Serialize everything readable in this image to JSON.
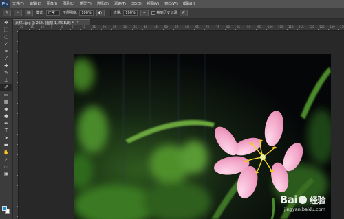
{
  "app": {
    "logo": "Ps"
  },
  "menu": [
    "文件(F)",
    "编辑(E)",
    "图像(I)",
    "图层(L)",
    "类型(Y)",
    "选择(S)",
    "滤镜(T)",
    "3D(D)",
    "视图(V)",
    "窗口(W)",
    "帮助(H)"
  ],
  "options": {
    "mode_label": "模式:",
    "mode_value": "正常",
    "opacity_label": "不透明度:",
    "opacity_value": "100%",
    "flow_label": "流量:",
    "flow_value": "100%",
    "history_label": "抹到历史记录"
  },
  "document": {
    "tab_title": "素材1.jpg @ 25% (图层 1, RGB/8) *",
    "close": "×"
  },
  "ruler_top": [
    "20",
    "15",
    "10",
    "5",
    "0",
    "5",
    "10",
    "15",
    "20",
    "25",
    "30",
    "35",
    "40",
    "45",
    "50",
    "55",
    "60",
    "65",
    "70",
    "75",
    "80",
    "85",
    "90",
    "95",
    "100",
    "105",
    "110",
    "115",
    "120",
    "125",
    "130",
    "135"
  ],
  "watermark": {
    "brand": "Bai",
    "brand2": "经验",
    "url": "jingyan.baidu.com"
  },
  "colors": {
    "foreground": "#1a8fd8",
    "background": "#ffffff",
    "petal": "#f2a8c8",
    "stamen": "#f5d230"
  },
  "tools": [
    "move",
    "marquee",
    "lasso",
    "quick-select",
    "crop",
    "eyedropper",
    "healing",
    "brush",
    "clone-stamp",
    "history-brush",
    "eraser",
    "gradient",
    "blur",
    "dodge",
    "pen",
    "type",
    "path-select",
    "shape",
    "hand",
    "zoom"
  ]
}
